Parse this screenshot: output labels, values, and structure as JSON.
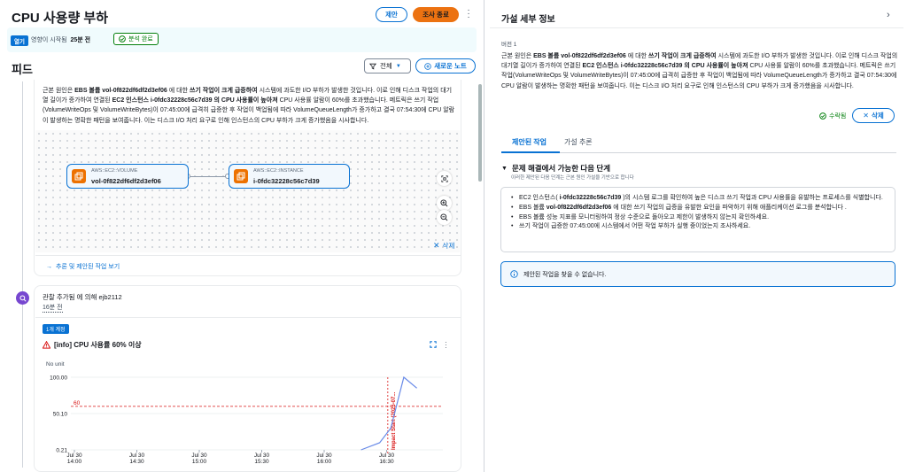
{
  "header": {
    "title": "CPU 사용량 부하",
    "suggest_button": "제안",
    "end_investigation_button": "조사 종료",
    "status_tag": "열기",
    "started_prefix": "영향이 시작됨",
    "started_value": "25분 전",
    "analysis_badge": "분석 완료"
  },
  "feed": {
    "title": "피드",
    "filter_label": "전체",
    "new_note_button": "새로운 노트",
    "hypothesis_card": {
      "text_parts": [
        "근본 원인은 ",
        "EBS 볼륨 vol-0f822df6df2d3ef06",
        " 에 대한 ",
        "쓰기 작업이 크게 급증하여",
        " 시스템에 과도한 I/O 부하가 발생한 것입니다. 이로 인해 디스크 작업의 대기열 길이가 증가하여 연결된 ",
        "EC2 인스턴스 i-0fdc32228c56c7d39 의 CPU 사용률이 높아져",
        " CPU 사용률 알람이 60%를 초과했습니다. 메트릭은 쓰기 작업(VolumeWriteOps 및 VolumeWriteBytes)이 07:45:00에 급격히 급증한 후 작업이 백업됨에 따라 VolumeQueueLength가 증가하고 결국 07:54:30에 CPU 알람이 발생하는 명확한 패턴을 보여줍니다. 이는 디스크 I/O 처리 요구로 인해 인스턴스의 CPU 부하가 크게 증가했음을 시사합니다."
      ],
      "node1": {
        "type": "AWS::EC2::VOLUME",
        "name": "vol-0f822df6df2d3ef06"
      },
      "node2": {
        "type": "AWS::EC2::INSTANCE",
        "name": "i-0fdc32228c56c7d39"
      },
      "delete_label": "삭제",
      "suggestions_link": "추론 및 제안된 작업 보기"
    },
    "observation_card": {
      "added_by": "관찰 추가됨 에 의해 ejb2112",
      "time": "16분 전",
      "count_tag": "1개 계정",
      "alarm_title": "[info] CPU 사용률 60% 이상",
      "no_unit": "No unit",
      "threshold_label": "60",
      "annotation": "Impact Start (2025-07..."
    }
  },
  "chart_data": {
    "type": "line",
    "title": "[info] CPU 사용률 60% 이상",
    "ylabel": "No unit",
    "yticks": [
      "100.00",
      "50.10",
      "0.21"
    ],
    "ylim": [
      0.21,
      100.0
    ],
    "xticks": [
      [
        "Jul 30",
        "14:00"
      ],
      [
        "Jul 30",
        "14:30"
      ],
      [
        "Jul 30",
        "15:00"
      ],
      [
        "Jul 30",
        "15:30"
      ],
      [
        "Jul 30",
        "16:00"
      ],
      [
        "Jul 30",
        "16:30"
      ]
    ],
    "threshold": 60,
    "series": [
      {
        "points": [
          [
            0.78,
            0.21
          ],
          [
            0.83,
            10
          ],
          [
            0.86,
            30
          ],
          [
            0.895,
            100
          ],
          [
            0.93,
            85
          ]
        ]
      }
    ]
  },
  "hypothesis_detail": {
    "title": "가설 세부 정보",
    "version": "버전 1",
    "useful_label": "수락됨",
    "delete_label": "삭제",
    "tabs": [
      "제안된 작업",
      "가설 추론"
    ],
    "steps_title": "문제 해결에서 가능한 다음 단계",
    "steps_subtitle": "이러한 제안된 다음 단계는 근본 원인 가설을 기반으로 합니다",
    "steps": [
      [
        "EC2 인스턴스( ",
        "i-0fdc32228c56c7d39",
        " )의 시스템 로그를 확인하여 높은 디스크 쓰기 작업과 CPU 사용률을 유발하는 프로세스를 식별합니다."
      ],
      [
        "EBS 볼륨 ",
        "vol-0f822df6df2d3ef06",
        " 에 대한 쓰기 작업의 급증을 유발한 요인을 파악하기 위해 애플리케이션 로그를 분석합니다 ."
      ],
      [
        "EBS 볼륨 성능 지표를 모니터링하여 정상 수준으로 돌아오고 제한이 발생하지 않는지 확인하세요.",
        "",
        ""
      ],
      [
        "쓰기 작업이 급증한 07:45:00에 시스템에서 어떤 작업 부하가 실행 중이었는지 조사하세요.",
        "",
        ""
      ]
    ],
    "info_text": "제안된 작업을 찾을 수 없습니다."
  },
  "colors": {
    "accent": "#0972d3",
    "orange": "#ec7211",
    "success": "#037f0c",
    "threshold": "#d91515"
  }
}
